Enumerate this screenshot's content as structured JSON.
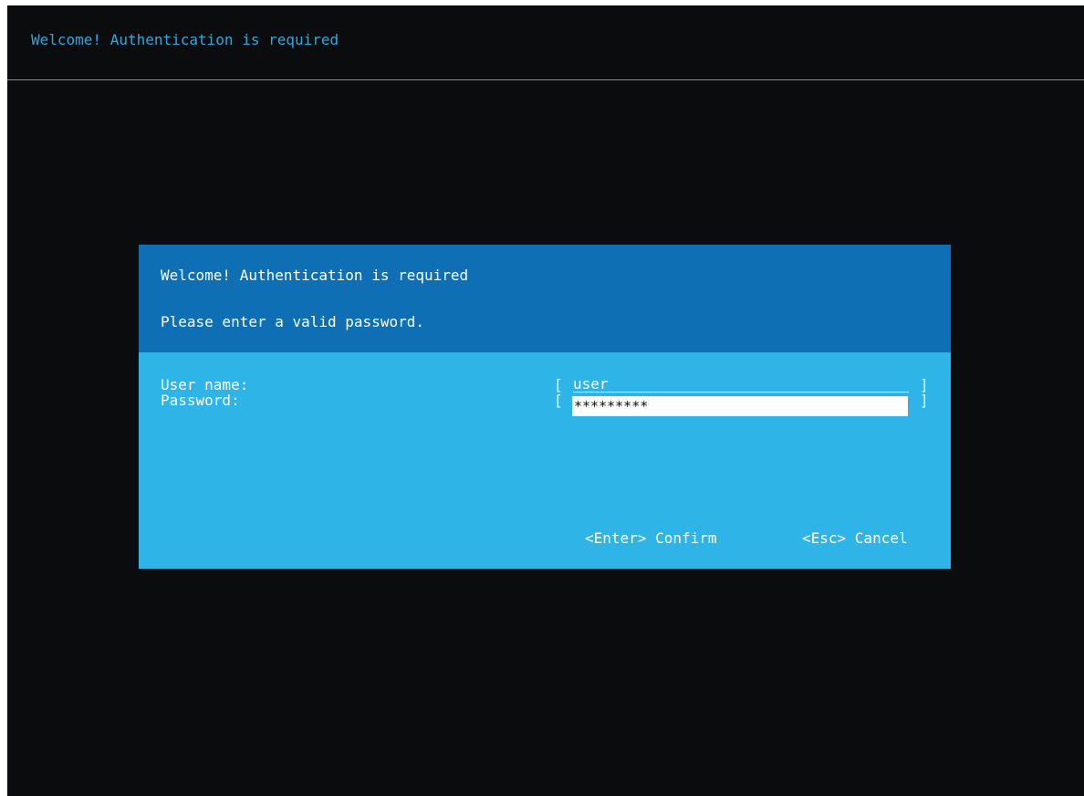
{
  "screen": {
    "title": "Welcome! Authentication is required"
  },
  "dialog": {
    "title": "Welcome! Authentication is required",
    "subtitle": "Please enter a valid password.",
    "fields": {
      "username_label": "User name:",
      "username_value": "user",
      "password_label": "Password:",
      "password_value": "*********"
    },
    "brackets": {
      "open": "[",
      "close": "]"
    },
    "actions": {
      "confirm": "<Enter> Confirm",
      "cancel": "<Esc> Cancel"
    }
  },
  "colors": {
    "background": "#0a0c0e",
    "accent": "#2fa8dd",
    "dialog_header": "#0f6fb5",
    "dialog_body": "#2fb4e8",
    "text": "#ffffff"
  }
}
